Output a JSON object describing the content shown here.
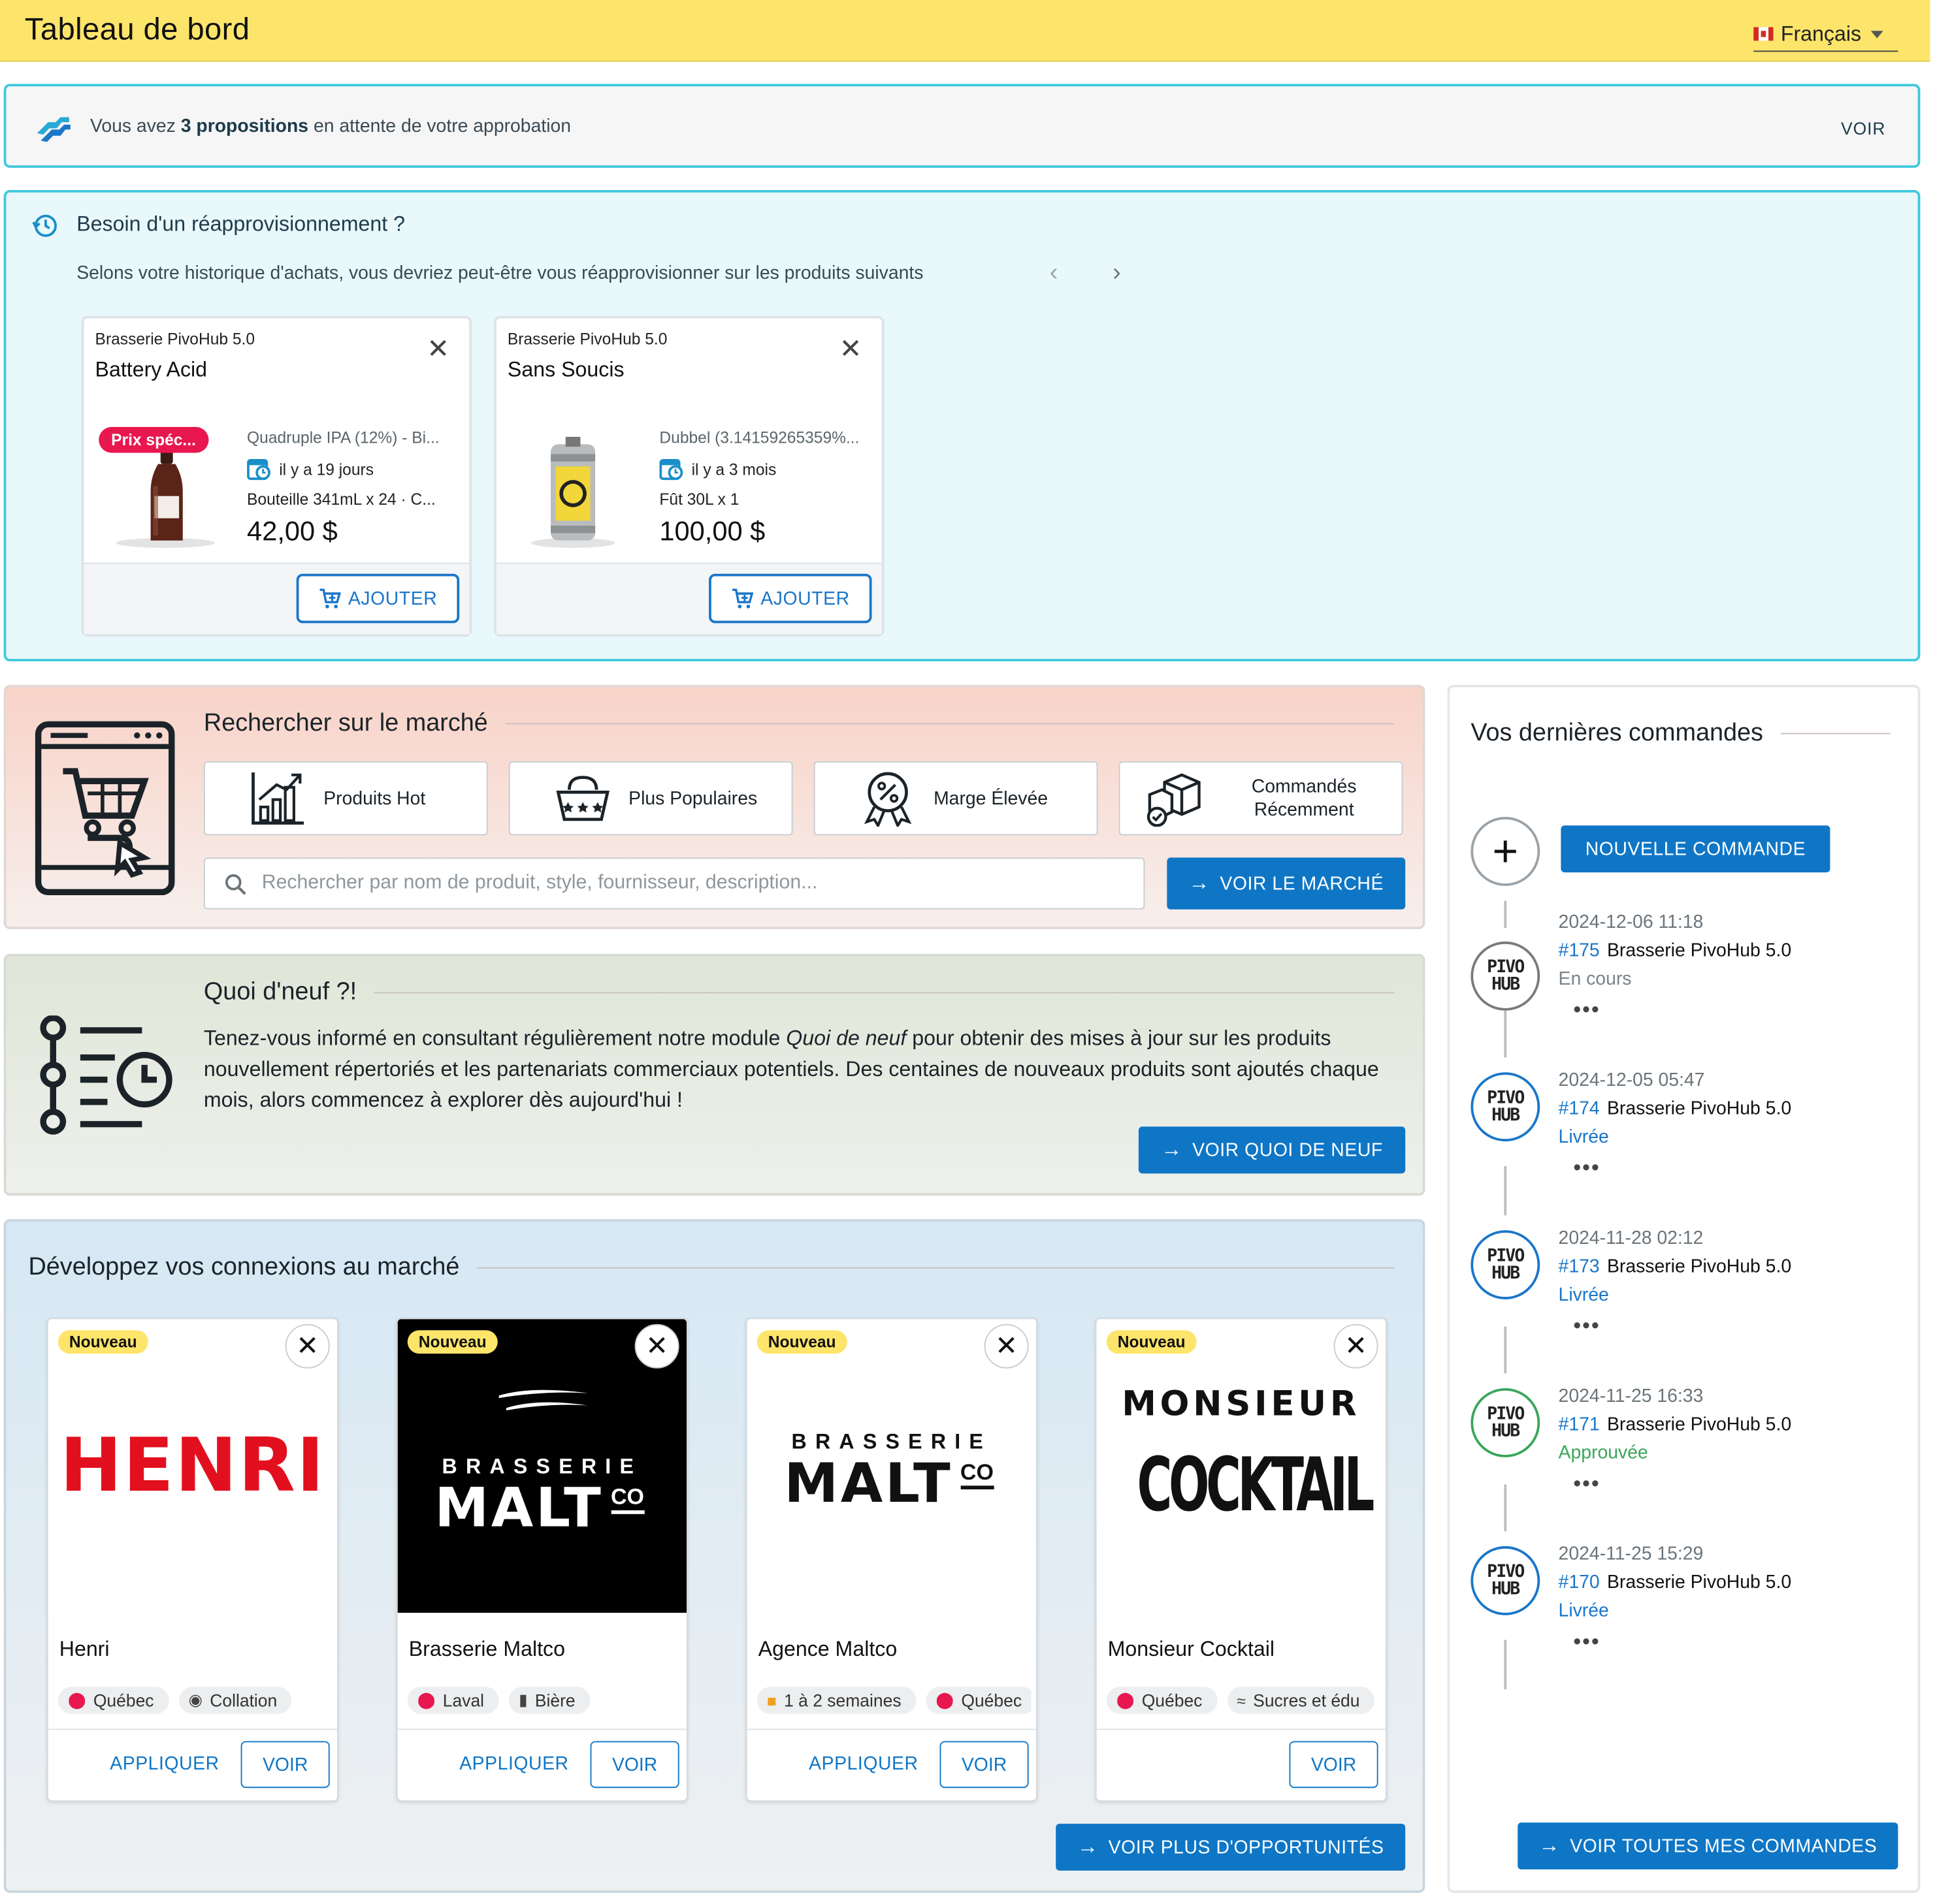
{
  "header": {
    "title": "Tableau de bord",
    "language": "Français"
  },
  "proposals_banner": {
    "text_before": "Vous avez ",
    "count_label": "3 propositions",
    "text_after": " en attente de votre approbation",
    "action": "VOIR"
  },
  "reorder": {
    "title": "Besoin d'un réapprovisionnement ?",
    "subtitle": "Selons votre historique d'achats, vous devriez peut-être vous réapprovisionner sur les produits suivants",
    "add_label": "AJOUTER",
    "products": [
      {
        "supplier": "Brasserie PivoHub 5.0",
        "name": "Battery Acid",
        "badge": "Prix spéc...",
        "description": "Quadruple IPA (12%) - Bi...",
        "last_order": "il y a 19 jours",
        "format": "Bouteille 341mL x 24 · C...",
        "price": "42,00 $",
        "image": "bottle"
      },
      {
        "supplier": "Brasserie PivoHub 5.0",
        "name": "Sans Soucis",
        "badge": "",
        "description": "Dubbel (3.14159265359%...",
        "last_order": "il y a 3 mois",
        "format": "Fût 30L x 1",
        "price": "100,00 $",
        "image": "keg"
      }
    ]
  },
  "market": {
    "title": "Rechercher sur le marché",
    "buttons": [
      {
        "label": "Produits Hot",
        "icon": "chart-growth-icon"
      },
      {
        "label": "Plus Populaires",
        "icon": "basket-icon"
      },
      {
        "label": "Marge Élevée",
        "icon": "percent-badge-icon"
      },
      {
        "label": "Commandés Récemment",
        "icon": "boxes-check-icon"
      }
    ],
    "search_placeholder": "Rechercher par nom de produit, style, fournisseur, description...",
    "cta": "VOIR LE MARCHÉ"
  },
  "news": {
    "title": "Quoi d'neuf ?!",
    "body_before": "Tenez-vous informé en consultant régulièrement notre module ",
    "body_italic": "Quoi de neuf",
    "body_after": " pour obtenir des mises à jour sur les produits nouvellement répertoriés et les partenariats commerciaux potentiels. Des centaines de nouveaux produits sont ajoutés chaque mois, alors commencez à explorer dès aujourd'hui !",
    "cta": "VOIR QUOI DE NEUF"
  },
  "connections": {
    "title": "Développez vos connexions au marché",
    "new_badge": "Nouveau",
    "apply_label": "APPLIQUER",
    "view_label": "VOIR",
    "cta": "VOIR PLUS D'OPPORTUNITÉS",
    "suppliers": [
      {
        "name": "Henri",
        "logo": "HENRI",
        "tags": [
          {
            "icon": "pin",
            "label": "Québec"
          },
          {
            "icon": "snack",
            "label": "Collation"
          }
        ],
        "apply": true
      },
      {
        "name": "Brasserie Maltco",
        "logo_top": "BRASSERIE",
        "logo_main": "MALT",
        "logo_co": "CO",
        "tags": [
          {
            "icon": "pin",
            "label": "Laval"
          },
          {
            "icon": "beer",
            "label": "Bière"
          }
        ],
        "apply": true
      },
      {
        "name": "Agence Maltco",
        "logo_top": "BRASSERIE",
        "logo_main": "MALT",
        "logo_co": "CO",
        "tags": [
          {
            "icon": "truck",
            "label": "1 à 2 semaines"
          },
          {
            "icon": "pin",
            "label": "Québec"
          }
        ],
        "apply": true
      },
      {
        "name": "Monsieur Cocktail",
        "logo_top": "MONSIEUR",
        "logo_main": "COCKTAIL",
        "tags": [
          {
            "icon": "pin",
            "label": "Québec"
          },
          {
            "icon": "sweet",
            "label": "Sucres et édu"
          }
        ],
        "apply": false
      }
    ]
  },
  "orders": {
    "title": "Vos dernières commandes",
    "new_order": "NOUVELLE COMMANDE",
    "cta": "VOIR TOUTES MES COMMANDES",
    "avatar_text": "PIVO HUB",
    "items": [
      {
        "date": "2024-12-06 11:18",
        "number": "#175",
        "supplier": "Brasserie PivoHub 5.0",
        "status": "En cours",
        "status_color": "#7a8389",
        "ring": "#7a7a7a"
      },
      {
        "date": "2024-12-05 05:47",
        "number": "#174",
        "supplier": "Brasserie PivoHub 5.0",
        "status": "Livrée",
        "status_color": "#1a76c9",
        "ring": "#1a76c9"
      },
      {
        "date": "2024-11-28 02:12",
        "number": "#173",
        "supplier": "Brasserie PivoHub 5.0",
        "status": "Livrée",
        "status_color": "#1a76c9",
        "ring": "#1a76c9"
      },
      {
        "date": "2024-11-25 16:33",
        "number": "#171",
        "supplier": "Brasserie PivoHub 5.0",
        "status": "Approuvée",
        "status_color": "#3aa65a",
        "ring": "#3aa65a"
      },
      {
        "date": "2024-11-25 15:29",
        "number": "#170",
        "supplier": "Brasserie PivoHub 5.0",
        "status": "Livrée",
        "status_color": "#1a76c9",
        "ring": "#1a76c9"
      }
    ]
  }
}
